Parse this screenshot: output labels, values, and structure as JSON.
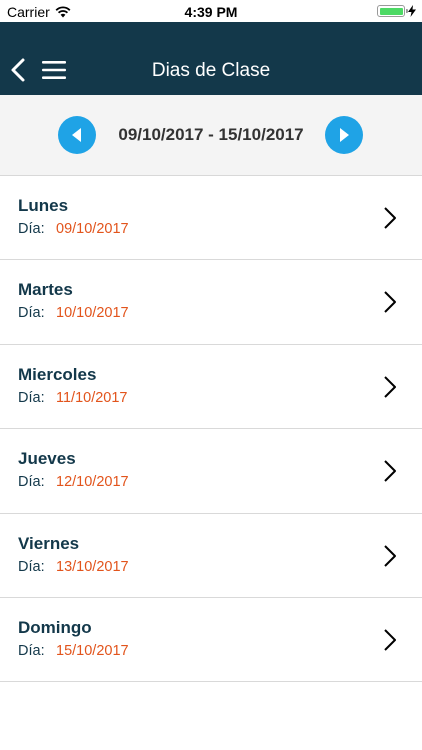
{
  "status_bar": {
    "carrier": "Carrier",
    "time": "4:39 PM"
  },
  "nav": {
    "title": "Dias de Clase",
    "back_icon": "chevron-left-icon",
    "menu_icon": "hamburger-menu-icon"
  },
  "week": {
    "range": "09/10/2017 - 15/10/2017",
    "prev_icon": "triangle-left-icon",
    "next_icon": "triangle-right-icon"
  },
  "days": [
    {
      "name": "Lunes",
      "label": "Día:",
      "date": "09/10/2017"
    },
    {
      "name": "Martes",
      "label": "Día:",
      "date": "10/10/2017"
    },
    {
      "name": "Miercoles",
      "label": "Día:",
      "date": "11/10/2017"
    },
    {
      "name": "Jueves",
      "label": "Día:",
      "date": "12/10/2017"
    },
    {
      "name": "Viernes",
      "label": "Día:",
      "date": "13/10/2017"
    },
    {
      "name": "Domingo",
      "label": "Día:",
      "date": "15/10/2017"
    }
  ],
  "colors": {
    "nav_background": "#13384a",
    "accent_blue": "#1fa3e6",
    "date_orange": "#e2541c",
    "battery_green": "#4cd964"
  }
}
